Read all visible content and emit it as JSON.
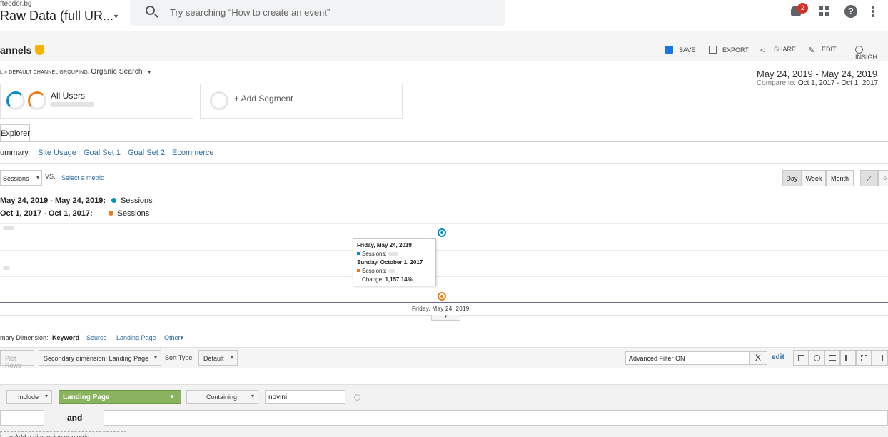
{
  "header": {
    "account_url": "fteodor.bg",
    "view_name": "Raw Data (full UR...",
    "search_placeholder": "Try searching “How to create an event”",
    "notification_count": "2",
    "help_symbol": "?"
  },
  "report": {
    "title": "annels",
    "actions": [
      "SAVE",
      "EXPORT",
      "SHARE",
      "EDIT",
      "INSIGH"
    ]
  },
  "breadcrumb": {
    "prefix": "L » DEFAULT CHANNEL GROUPING:",
    "value": "Organic Search"
  },
  "date": {
    "range": "May 24, 2019 - May 24, 2019",
    "compare_label": "Compare to:",
    "compare_range": "Oct 1, 2017 - Oct 1, 2017"
  },
  "segments": {
    "all_users": "All Users",
    "add_segment": "+ Add Segment"
  },
  "tabs": {
    "explorer": "Explorer",
    "subtabs": [
      "ummary",
      "Site Usage",
      "Goal Set 1",
      "Goal Set 2",
      "Ecommerce"
    ]
  },
  "metric": {
    "selected": "Sessions",
    "vs": "VS.",
    "select_metric": "Select a metric",
    "periods": [
      "Day",
      "Week",
      "Month"
    ]
  },
  "legend": [
    {
      "range": "May 24, 2019 - May 24, 2019:",
      "metric": "Sessions",
      "color": "#058dc7"
    },
    {
      "range": "Oct 1, 2017 - Oct 1, 2017:",
      "metric": "Sessions",
      "color": "#ed7e17"
    }
  ],
  "chart": {
    "tooltip": {
      "date1": "Friday, May 24, 2019",
      "metric1": "Sessions:",
      "date2": "Sunday, October 1, 2017",
      "metric2": "Sessions:",
      "change_label": "Change:",
      "change_value": "1,157.14%"
    },
    "x_label": "Friday, May 24, 2019"
  },
  "dimensions": {
    "label": "mary Dimension:",
    "active": "Keyword",
    "options": [
      "Source",
      "Landing Page",
      "Other"
    ]
  },
  "toolbar": {
    "plot_rows": "Plot Rows",
    "secondary": "Secondary dimension: Landing Page",
    "sort_label": "Sort Type:",
    "sort_value": "Default",
    "filter_value": "Advanced Filter ON",
    "filter_clear": "X",
    "edit": "edit"
  },
  "filter_builder": {
    "include": "Include",
    "dimension": "Landing Page",
    "match": "Containing",
    "value": "novini",
    "and": "and",
    "add_dimension": "+ Add a dimension or metric"
  }
}
